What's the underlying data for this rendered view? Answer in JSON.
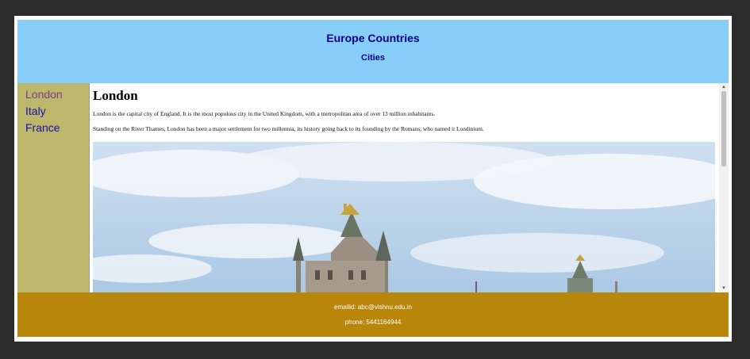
{
  "header": {
    "title": "Europe Countries",
    "subtitle": "Cities"
  },
  "sidebar": {
    "items": [
      {
        "label": "London",
        "state": "visited"
      },
      {
        "label": "Italy",
        "state": "link"
      },
      {
        "label": "France",
        "state": "link"
      }
    ]
  },
  "content": {
    "heading": "London",
    "paragraphs": [
      "London is the capital city of England. It is the most populous city in the United Kingdom, with a metropolitan area of over 13 million inhabitants.",
      "Standing on the River Thames, London has been a major settlement for two millennia, its history going back to its founding by the Romans, who named it Londinium."
    ],
    "image": "tower-bridge-photo"
  },
  "footer": {
    "email": "emailid: abc@vishnu.edu.in",
    "phone": "phone: 5441164944"
  },
  "colors": {
    "header_bg": "#87cefa",
    "header_text": "#00008b",
    "sidebar_bg": "#bdb76b",
    "footer_bg": "#b8860b"
  }
}
